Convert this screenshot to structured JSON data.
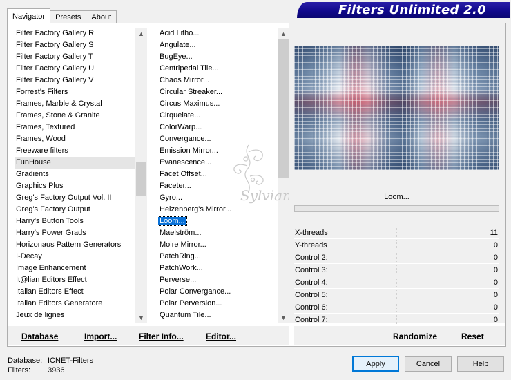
{
  "tabs": [
    "Navigator",
    "Presets",
    "About"
  ],
  "banner": "Filters Unlimited 2.0",
  "categories": [
    "Filter Factory Gallery R",
    "Filter Factory Gallery S",
    "Filter Factory Gallery T",
    "Filter Factory Gallery U",
    "Filter Factory Gallery V",
    "Forrest's Filters",
    "Frames, Marble & Crystal",
    "Frames, Stone & Granite",
    "Frames, Textured",
    "Frames, Wood",
    "Freeware filters",
    "FunHouse",
    "Gradients",
    "Graphics Plus",
    "Greg's Factory Output Vol. II",
    "Greg's Factory Output",
    "Harry's Button Tools",
    "Harry's Power Grads",
    "Horizonaus Pattern Generators",
    "I-Decay",
    "Image Enhancement",
    "It@lian Editors Effect",
    "Italian Editors Effect",
    "Italian Editors Generatore",
    "Jeux de lignes"
  ],
  "filters": [
    "Acid Litho...",
    "Angulate...",
    "BugEye...",
    "Centripedal Tile...",
    "Chaos Mirror...",
    "Circular Streaker...",
    "Circus Maximus...",
    "Cirquelate...",
    "ColorWarp...",
    "Convergance...",
    "Emission Mirror...",
    "Evanescence...",
    "Facet Offset...",
    "Faceter...",
    "Gyro...",
    "Heizenberg's Mirror...",
    "Loom...",
    "Maelström...",
    "Moire Mirror...",
    "PatchRing...",
    "PatchWork...",
    "Perverse...",
    "Polar Convergance...",
    "Polar Perversion...",
    "Quantum Tile..."
  ],
  "selected_filter": "Loom...",
  "params": [
    {
      "name": "X-threads",
      "value": "11"
    },
    {
      "name": "Y-threads",
      "value": "0"
    },
    {
      "name": "Control 2:",
      "value": "0"
    },
    {
      "name": "Control 3:",
      "value": "0"
    },
    {
      "name": "Control 4:",
      "value": "0"
    },
    {
      "name": "Control 5:",
      "value": "0"
    },
    {
      "name": "Control 6:",
      "value": "0"
    },
    {
      "name": "Control 7:",
      "value": "0"
    }
  ],
  "toolbar": {
    "database": "Database",
    "import": "Import...",
    "filter_info": "Filter Info...",
    "editor": "Editor...",
    "randomize": "Randomize",
    "reset": "Reset"
  },
  "footer": {
    "database_label": "Database:",
    "database_value": "ICNET-Filters",
    "filters_label": "Filters:",
    "filters_value": "3936"
  },
  "buttons": {
    "apply": "Apply",
    "cancel": "Cancel",
    "help": "Help"
  },
  "watermark": "Sylviane",
  "colors": {
    "banner": "#10088a",
    "selection": "#0a72d8"
  }
}
